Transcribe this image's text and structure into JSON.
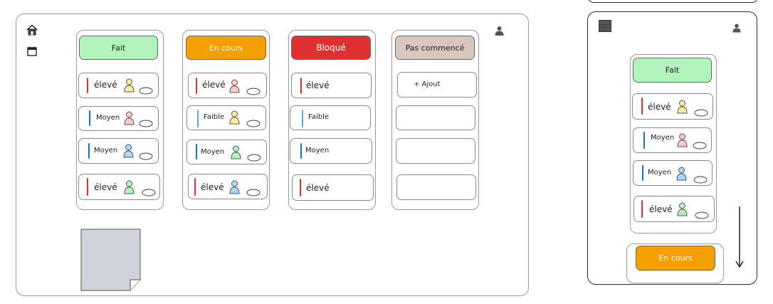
{
  "board": {
    "columns": [
      {
        "title": "Fait",
        "cards": [
          {
            "label": "élevé"
          },
          {
            "label": "Moyen"
          },
          {
            "label": "Moyen"
          },
          {
            "label": "élevé"
          }
        ]
      },
      {
        "title": "En cours",
        "cards": [
          {
            "label": "élevé"
          },
          {
            "label": "Faible"
          },
          {
            "label": "Moyen"
          },
          {
            "label": "élevé"
          }
        ]
      },
      {
        "title": "Bloqué",
        "cards": [
          {
            "label": "élevé"
          },
          {
            "label": "Faible"
          },
          {
            "label": "Moyen"
          },
          {
            "label": "élevé"
          }
        ]
      },
      {
        "title": "Pas commencé",
        "cards": [
          {
            "label": "+ Ajout"
          }
        ]
      }
    ]
  },
  "mobile": {
    "column_title": "Fait",
    "cards": [
      {
        "label": "élevé"
      },
      {
        "label": "Moyen"
      },
      {
        "label": "Moyen"
      },
      {
        "label": "élevé"
      }
    ],
    "next_column_title": "En cours"
  },
  "icons": {
    "sidebar": [
      "home-icon",
      "calendar-icon"
    ],
    "profile": "user-icon",
    "mobile_menu": "menu-icon",
    "sticky_note": "sticky-note"
  },
  "colors": {
    "done": "#b2f2bb",
    "in_progress": "#f59f00",
    "blocked": "#e03131",
    "not_started": "#d7c7bd",
    "priority_high": "#e03131",
    "priority_low": "#4dabf7",
    "priority_medium": "#1971c2",
    "person_yellow": "#ffec99",
    "person_pink": "#ffc9c9",
    "person_blue": "#a5d8ff",
    "person_green": "#b2f2bb"
  }
}
